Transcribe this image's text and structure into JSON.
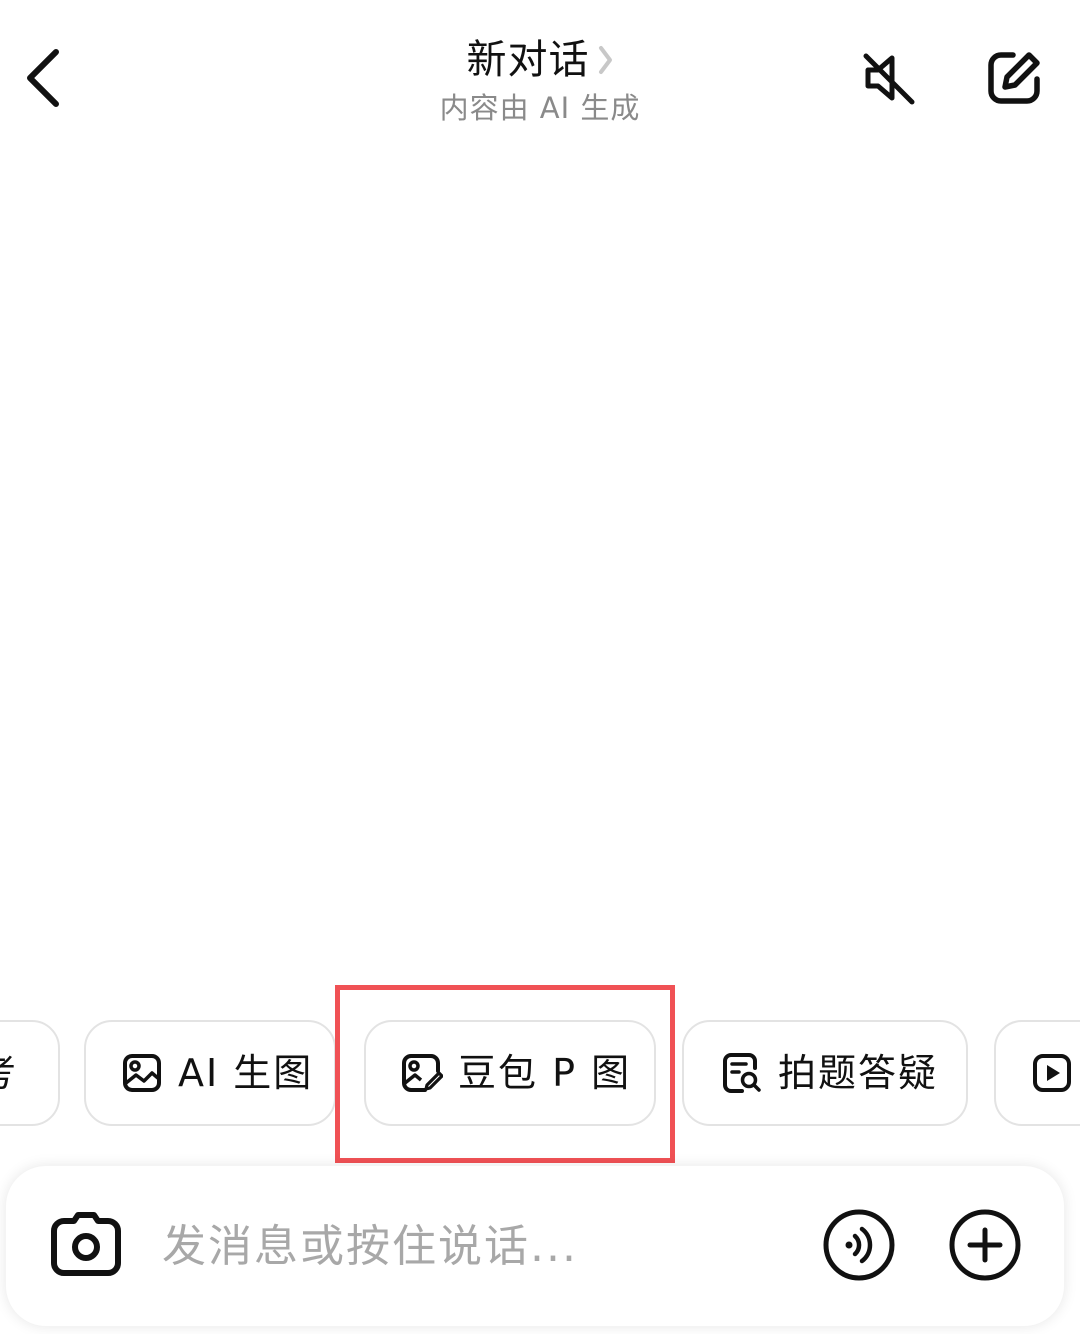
{
  "header": {
    "title": "新对话",
    "subtitle": "内容由 AI 生成",
    "back_icon": "chevron-left-icon",
    "title_chevron_icon": "chevron-right-icon",
    "mute_icon": "speaker-muted-icon",
    "new_chat_icon": "edit-square-icon"
  },
  "chips": {
    "partial_left_label": "考",
    "items": [
      {
        "label": "AI 生图",
        "icon": "image-icon"
      },
      {
        "label": "豆包 P 图",
        "icon": "image-edit-icon"
      },
      {
        "label": "拍题答疑",
        "icon": "document-search-icon"
      }
    ],
    "partial_right_icon": "video-play-icon",
    "highlighted_index": 1
  },
  "input_bar": {
    "placeholder": "发消息或按住说话...",
    "camera_icon": "camera-icon",
    "voice_icon": "voice-call-icon",
    "plus_icon": "plus-circle-icon"
  },
  "colors": {
    "background": "#ffffff",
    "text_primary": "#111111",
    "text_secondary": "#8a8a8a",
    "placeholder": "#a8a8a8",
    "chip_border": "#e3e3e3",
    "highlight": "#f05155"
  }
}
